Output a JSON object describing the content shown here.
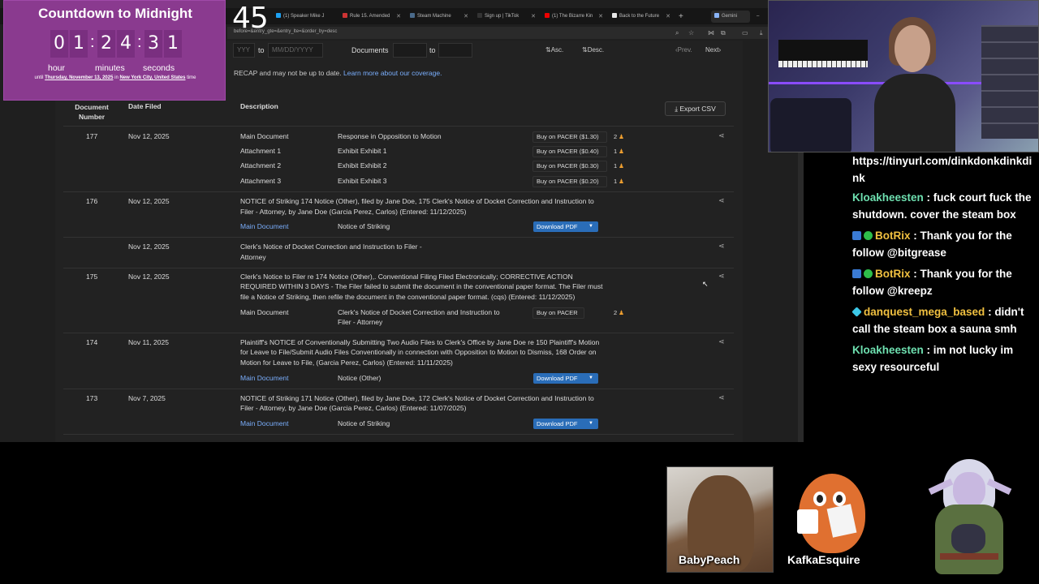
{
  "browser": {
    "tabs": [
      {
        "label": "(1) Speaker Mike J",
        "fav": "#1da1f2"
      },
      {
        "label": "Rule 15. Amended",
        "fav": "#c33"
      },
      {
        "label": "Steam Machine",
        "fav": "#1b2838"
      },
      {
        "label": "Sign up | TikTok",
        "fav": "#111"
      },
      {
        "label": "(1) The Bizarre Kin",
        "fav": "#e00"
      },
      {
        "label": "Back to the Future",
        "fav": "#e8e8e8"
      },
      {
        "label": "Gemini",
        "fav": "#8ab4f8"
      }
    ],
    "new_tab": "+",
    "url": "before=&entry_gte=&entry_lte=&order_by=desc",
    "minimize": "–"
  },
  "filters": {
    "date_from_placeholder": "YYY",
    "to1": "to",
    "date_to_placeholder": "MM/DD/YYYY",
    "documents": "Documents",
    "to2": "to",
    "asc": "Asc.",
    "desc": "Desc.",
    "prev": "Prev.",
    "next": "Next"
  },
  "notice": {
    "text": "RECAP and may not be up to date.",
    "link": "Learn more about our coverage."
  },
  "table": {
    "headers": {
      "doc_num": "Document Number",
      "date_filed": "Date Filed",
      "description": "Description"
    },
    "export": "Export CSV",
    "entries": [
      {
        "number": "177",
        "date": "Nov 12, 2025",
        "docs": [
          {
            "part": "Main Document",
            "desc": "Response in Opposition to Motion",
            "buy": "Buy on PACER ($1.30)",
            "qty": "2"
          },
          {
            "part": "Attachment 1",
            "desc": "Exhibit Exhibit 1",
            "buy": "Buy on PACER ($0.40)",
            "qty": "1"
          },
          {
            "part": "Attachment 2",
            "desc": "Exhibit Exhibit 2",
            "buy": "Buy on PACER ($0.30)",
            "qty": "1"
          },
          {
            "part": "Attachment 3",
            "desc": "Exhibit Exhibit 3",
            "buy": "Buy on PACER ($0.20)",
            "qty": "1"
          }
        ]
      },
      {
        "number": "176",
        "date": "Nov 12, 2025",
        "text1": "NOTICE of Striking 174 Notice (Other), filed by Jane Doe, 175 Clerk's Notice of Docket Correction and Instruction to",
        "text2": "Filer - Attorney, by Jane Doe (Garcia Perez, Carlos) (Entered: 11/12/2025)",
        "part": "Main Document",
        "desc": "Notice of Striking",
        "download": "Download PDF"
      },
      {
        "number": "",
        "date": "Nov 12, 2025",
        "text1": "Clerk's Notice of Docket Correction and Instruction to Filer -",
        "text2": "Attorney"
      },
      {
        "number": "175",
        "date": "Nov 12, 2025",
        "text1": "Clerk's Notice to Filer re 174 Notice (Other),. Conventional Filing Filed Electronically; CORRECTIVE ACTION",
        "text2": "REQUIRED WITHIN 3 DAYS - The Filer failed to submit the document in the conventional paper format. The Filer must",
        "text3": "file a Notice of Striking, then refile the document in the conventional paper format. (cqs) (Entered: 11/12/2025)",
        "part": "Main Document",
        "desc1": "Clerk's Notice of Docket Correction and Instruction to",
        "desc2": "Filer - Attorney",
        "buy": "Buy on PACER",
        "qty": "2"
      },
      {
        "number": "174",
        "date": "Nov 11, 2025",
        "text1": "Plaintiff's NOTICE of Conventionally Submitting Two Audio Files to Clerk's Office by Jane Doe re 150 Plaintiff's Motion",
        "text2": "for Leave to File/Submit Audio Files Conventionally in connection with Opposition to Motion to Dismiss, 168 Order on",
        "text3": "Motion for Leave to File, (Garcia Perez, Carlos) (Entered: 11/11/2025)",
        "part": "Main Document",
        "desc": "Notice (Other)",
        "download": "Download PDF"
      },
      {
        "number": "173",
        "date": "Nov 7, 2025",
        "text1": "NOTICE of Striking 171 Notice (Other), filed by Jane Doe, 172 Clerk's Notice of Docket Correction and Instruction to",
        "text2": "Filer - Attorney, by Jane Doe (Garcia Perez, Carlos) (Entered: 11/07/2025)",
        "part": "Main Document",
        "desc": "Notice of Striking",
        "download": "Download PDF"
      }
    ]
  },
  "countdown": {
    "title": "Countdown to Midnight",
    "digits": [
      "0",
      "1",
      "2",
      "4",
      "3",
      "1"
    ],
    "colon": ":",
    "units": {
      "hour": "hour",
      "minutes": "minutes",
      "seconds": "seconds"
    },
    "until_prefix": "until",
    "until_date": "Thursday, November 13, 2025",
    "until_in": "in",
    "until_place": "New York City, United States",
    "until_suffix": "time"
  },
  "overlay_number": "45",
  "chat": [
    {
      "user": "",
      "text": "https://tinyurl.com/dinkdonkdinkdink"
    },
    {
      "user": "Kloakheesten",
      "sep": " : ",
      "text": "fuck court fuck the shutdown. cover the steam box",
      "color": "#6ee0b0"
    },
    {
      "user": "BotRix",
      "sep": " : ",
      "text": "Thank you for the follow @bitgrease",
      "color": "#f0c040"
    },
    {
      "user": "BotRix",
      "sep": " : ",
      "text": "Thank you for the follow @kreepz",
      "color": "#f0c040"
    },
    {
      "user": "danquest_mega_based",
      "sep": " : ",
      "text": "didn't call the steam box a sauna smh",
      "color": "#f0c040"
    },
    {
      "user": "Kloakheesten",
      "sep": " : ",
      "text": "im not lucky im sexy resourceful",
      "color": "#6ee0b0"
    }
  ],
  "avatars": {
    "peach": "BabyPeach",
    "kafka": "KafkaEsquire"
  },
  "colors": {
    "link": "#7aaefc",
    "download_button": "#2a6db8",
    "countdown_bg": "#8a3a8f"
  }
}
